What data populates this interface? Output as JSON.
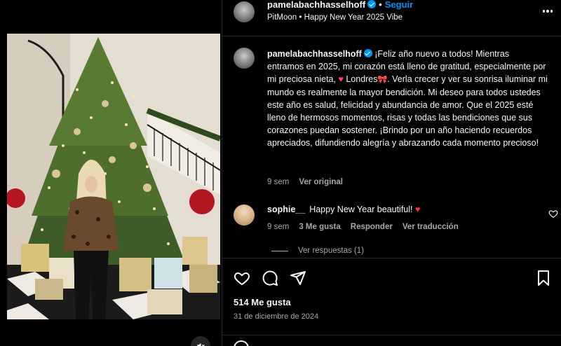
{
  "header": {
    "username": "pamelabachhasselhoff",
    "separator": "•",
    "follow_label": "Seguir",
    "subtitle": "PitMoon • Happy New Year 2025 Vibe"
  },
  "caption": {
    "username": "pamelabachhasselhoff",
    "text_part1": "¡Feliz año nuevo a todos! Mientras entramos en 2025, mi corazón está lleno de gratitud, especialmente por mi preciosa nieta, ",
    "emoji_heart": "♥",
    "text_part2": " Londres",
    "emoji_bow": "🎀",
    "text_part3": ". Verla crecer y ver su sonrisa iluminar mi mundo es realmente la mayor bendición. Mi deseo para todos ustedes este año es salud, felicidad y abundancia de amor. Que el 2025 esté lleno de hermosos momentos, risas y todas las bendiciones que sus corazones puedan sostener. ¡Brindo por un año haciendo recuerdos apreciados, difundiendo alegría y abrazando cada momento precioso!",
    "time": "9 sem",
    "see_original": "Ver original"
  },
  "comment": {
    "username": "sophie__",
    "text": "Happy New Year beautiful!",
    "emoji_heart": "♥",
    "time": "9 sem",
    "likes": "3 Me gusta",
    "reply": "Responder",
    "see_translation": "Ver traducción",
    "view_replies": "Ver respuestas (1)"
  },
  "stats": {
    "likes": "514 Me gusta",
    "date": "31 de diciembre de 2024"
  },
  "icons": {
    "like": "heart-icon",
    "comment": "comment-icon",
    "share": "share-icon",
    "save": "bookmark-icon",
    "more": "more-icon",
    "verified": "verified-badge-icon",
    "mute": "muted-speaker-icon"
  },
  "colors": {
    "background": "#000000",
    "link": "#0095f6",
    "secondary_text": "#a8a8a8",
    "heart_pink": "#ff3d7f",
    "heart_red": "#ff3040",
    "divider": "#262626"
  }
}
